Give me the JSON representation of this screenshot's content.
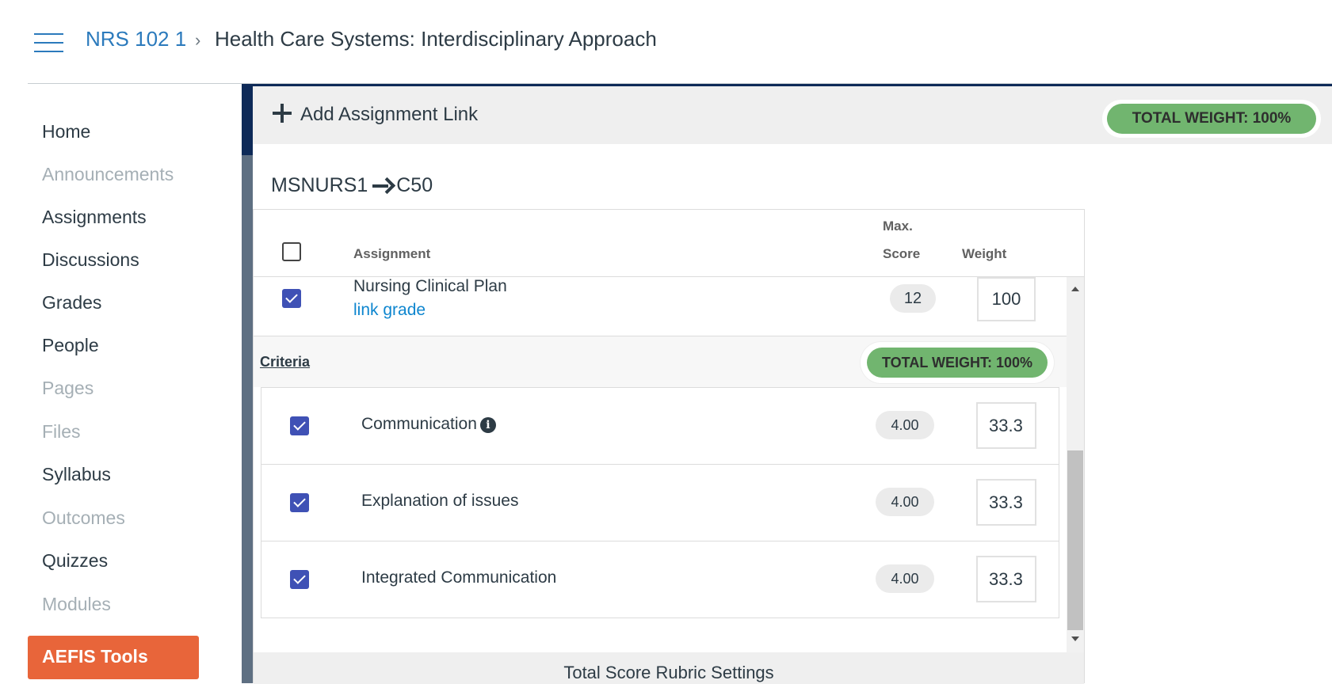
{
  "header": {
    "course": "NRS 102 1",
    "separator": "›",
    "page_title": "Health Care Systems: Interdisciplinary Approach"
  },
  "nav": {
    "items": [
      {
        "label": "Home",
        "enabled": true
      },
      {
        "label": "Announcements",
        "enabled": false
      },
      {
        "label": "Assignments",
        "enabled": true
      },
      {
        "label": "Discussions",
        "enabled": true
      },
      {
        "label": "Grades",
        "enabled": true
      },
      {
        "label": "People",
        "enabled": true
      },
      {
        "label": "Pages",
        "enabled": false
      },
      {
        "label": "Files",
        "enabled": false
      },
      {
        "label": "Syllabus",
        "enabled": true
      },
      {
        "label": "Outcomes",
        "enabled": false
      },
      {
        "label": "Quizzes",
        "enabled": true
      },
      {
        "label": "Modules",
        "enabled": false
      }
    ],
    "aefis_label": "AEFIS Tools"
  },
  "toolbar": {
    "add_link_label": "Add Assignment Link",
    "total_weight": "TOTAL WEIGHT: 100%"
  },
  "mapping": {
    "source": "MSNURS1",
    "target": "C50"
  },
  "table": {
    "headers": {
      "assignment": "Assignment",
      "max": "Max.",
      "score": "Score",
      "weight": "Weight"
    },
    "assignment": {
      "title": "Nursing Clinical Plan",
      "link_text": "link grade",
      "max_score": "12",
      "weight": "100",
      "checked": true
    },
    "criteria": {
      "label": "Criteria",
      "total_weight": "TOTAL WEIGHT: 100%",
      "rows": [
        {
          "name": "Communication",
          "max_score": "4.00",
          "weight": "33.3",
          "checked": true,
          "has_info": true
        },
        {
          "name": "Explanation of issues",
          "max_score": "4.00",
          "weight": "33.3",
          "checked": true,
          "has_info": false
        },
        {
          "name": "Integrated Communication",
          "max_score": "4.00",
          "weight": "33.3",
          "checked": true,
          "has_info": false
        }
      ]
    },
    "footer_label": "Total Score Rubric Settings"
  },
  "colors": {
    "link_blue": "#2b7abc",
    "aefis_orange": "#e8653a",
    "weight_green": "#71b56f",
    "checkbox_indigo": "#3f51b5"
  }
}
